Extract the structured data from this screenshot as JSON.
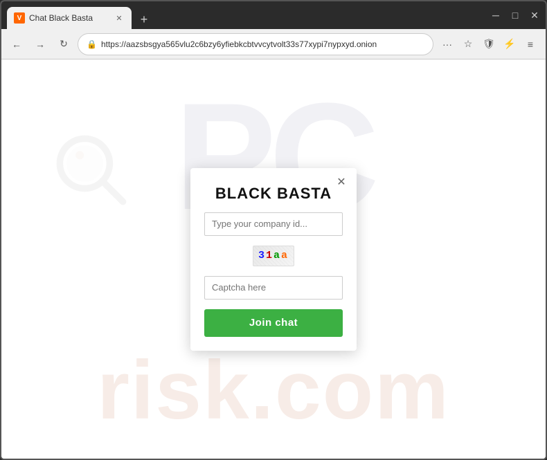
{
  "browser": {
    "tab_title": "Chat Black Basta",
    "tab_favicon": "V",
    "new_tab_icon": "+",
    "window_minimize": "─",
    "window_maximize": "□",
    "window_close": "✕",
    "back_icon": "←",
    "forward_icon": "→",
    "reload_icon": "↻",
    "address_url": "https://aazsbsgya565vlu2c6bzy6yfiebkcbtvvcytvolt33s77xypi7nypxyd.onion",
    "security_icon": "🔒",
    "more_icon": "···",
    "bookmark_icon": "☆",
    "shield_icon": "🛡",
    "extension_icon": "⚡",
    "menu_icon": "≡"
  },
  "modal": {
    "title": "BLACK BASTA",
    "close_icon": "✕",
    "company_id_placeholder": "Type your company id...",
    "captcha_text": "31aa",
    "captcha_input_placeholder": "Captcha here",
    "join_button_label": "Join chat"
  },
  "watermark": {
    "pc_text": "PC",
    "risk_text": "risk.com"
  }
}
